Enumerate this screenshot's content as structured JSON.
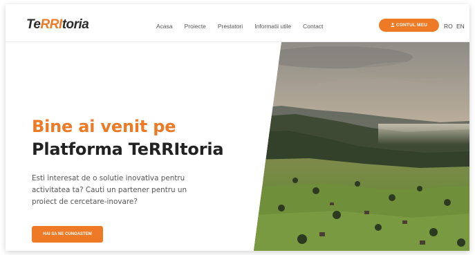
{
  "brand": {
    "logo_pre": "Te",
    "logo_accent": "RRI",
    "logo_post": "toria",
    "accent_color": "#ee7a26"
  },
  "nav": {
    "items": [
      {
        "label": "Acasa"
      },
      {
        "label": "Proiecte"
      },
      {
        "label": "Prestatori"
      },
      {
        "label": "Informatii utile"
      },
      {
        "label": "Contact"
      }
    ]
  },
  "header": {
    "account_label": "CONTUL MEU",
    "account_icon": "user-icon",
    "lang_ro": "RO",
    "lang_en": "EN"
  },
  "hero": {
    "title_line1": "Bine ai venit pe",
    "title_line2": "Platforma TeRRItoria",
    "text": "Esti interesat de o solutie inovativa pentru activitatea ta? Cauti un partener pentru un proiect de cercetare-inovare?",
    "cta_label": "HAI SA NE CUNOASTEM",
    "image": "mountain-valley-landscape"
  }
}
